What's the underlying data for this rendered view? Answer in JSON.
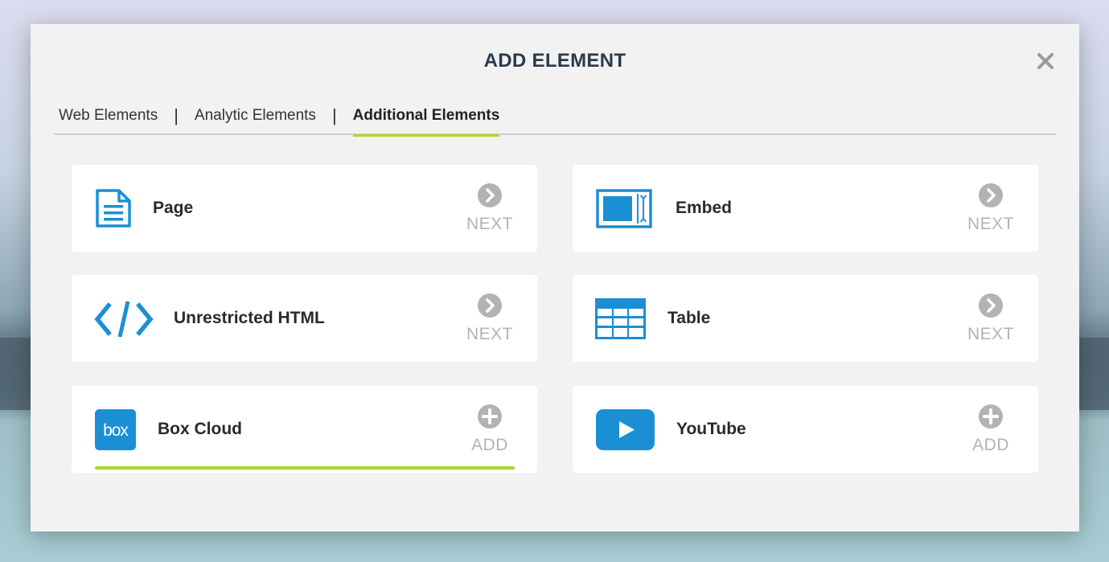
{
  "dialog": {
    "title": "ADD ELEMENT",
    "close_icon": "close-icon"
  },
  "tabs": [
    {
      "label": "Web Elements",
      "active": false
    },
    {
      "label": "Analytic Elements",
      "active": false
    },
    {
      "label": "Additional Elements",
      "active": true
    }
  ],
  "tab_separator": "|",
  "elements": [
    {
      "label": "Page",
      "icon": "document-icon",
      "action": "NEXT",
      "action_icon": "chevron-right-icon"
    },
    {
      "label": "Embed",
      "icon": "embed-icon",
      "action": "NEXT",
      "action_icon": "chevron-right-icon"
    },
    {
      "label": "Unrestricted HTML",
      "icon": "code-icon",
      "action": "NEXT",
      "action_icon": "chevron-right-icon"
    },
    {
      "label": "Table",
      "icon": "table-icon",
      "action": "NEXT",
      "action_icon": "chevron-right-icon"
    },
    {
      "label": "Box Cloud",
      "icon": "box-logo-icon",
      "logo_text": "box",
      "action": "ADD",
      "action_icon": "plus-icon"
    },
    {
      "label": "YouTube",
      "icon": "youtube-play-icon",
      "action": "ADD",
      "action_icon": "plus-icon"
    }
  ],
  "colors": {
    "accent": "#a9d82b",
    "icon_blue": "#1b8fd6",
    "action_gray": "#b3b3b3",
    "title": "#2b3a4a"
  }
}
